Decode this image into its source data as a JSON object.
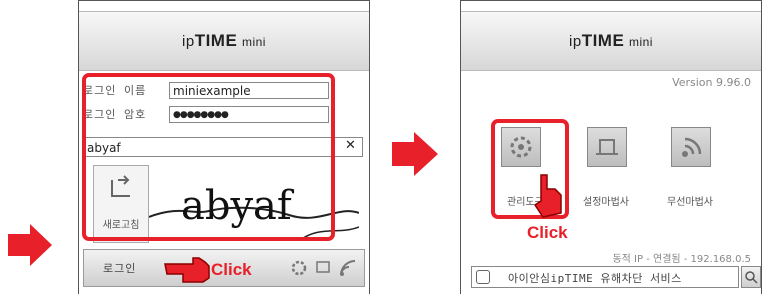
{
  "left_panel": {
    "logo": {
      "brand": "ipTIME",
      "model": "mini"
    },
    "username_label": "로그인 이름",
    "username_value": "miniexample",
    "password_label": "로그인 암호",
    "password_value": "●●●●●●●●",
    "captcha_input": "abyaf",
    "clear_symbol": "✕",
    "refresh_label": "새로고침",
    "captcha_text": "abyaf",
    "login_button": "로그인",
    "click_label": "Click"
  },
  "right_panel": {
    "logo": {
      "brand": "ipTIME",
      "model": "mini"
    },
    "version": "Version 9.96.0",
    "icons": [
      {
        "name": "admin-settings",
        "label": "관리도구"
      },
      {
        "name": "setup-wizard",
        "label": "설정마법사"
      },
      {
        "name": "wireless-wizard",
        "label": "무선마법사"
      }
    ],
    "click_label": "Click",
    "status": "동적 IP - 연결됨 - 192.168.0.5",
    "search_placeholder": "아이안심ipTIME 유해차단 서비스"
  },
  "colors": {
    "accent": "#e8202a",
    "frame": "#555555"
  }
}
